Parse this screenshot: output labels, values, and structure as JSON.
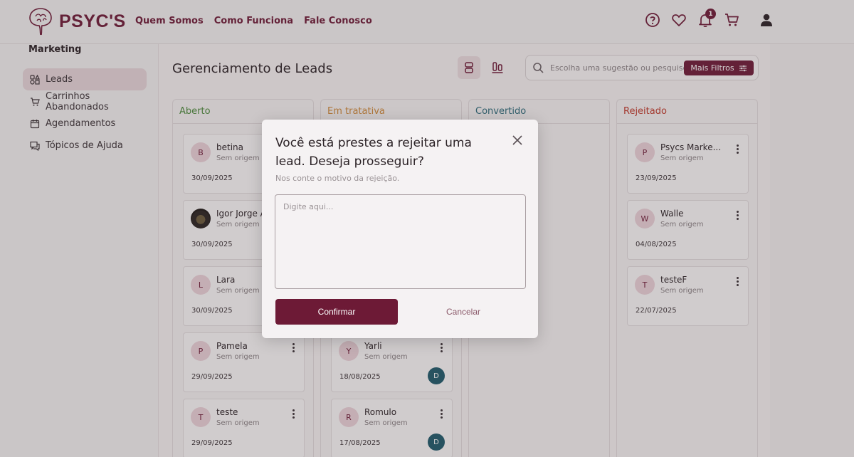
{
  "header": {
    "brand": "PSYC'S",
    "nav": [
      "Quem Somos",
      "Como Funciona",
      "Fale Conosco"
    ],
    "notification_count": "1",
    "icons": [
      "help-icon",
      "heart-icon",
      "bell-icon",
      "cart-icon",
      "user-icon"
    ]
  },
  "sidebar": {
    "section_title": "Marketing",
    "items": [
      {
        "label": "Leads",
        "icon": "leads-icon",
        "active": true
      },
      {
        "label": "Carrinhos Abandonados",
        "icon": "cart-icon"
      },
      {
        "label": "Agendamentos",
        "icon": "calendar-icon"
      },
      {
        "label": "Tópicos de Ajuda",
        "icon": "help-topics-icon"
      }
    ]
  },
  "main": {
    "title": "Gerenciamento de Leads",
    "search_placeholder": "Escolha uma sugestão ou pesquise...",
    "filter_label": "Mais Filtros"
  },
  "columns": [
    {
      "title": "Aberto",
      "color": "#4a8a3a",
      "cards": [
        {
          "initial": "B",
          "name": "betina",
          "origin": "Sem origem",
          "date": "30/09/2025"
        },
        {
          "initial": "",
          "name": "Igor Jorge A",
          "origin": "Sem origem",
          "date": "30/09/2025",
          "photo": true
        },
        {
          "initial": "L",
          "name": "Lara",
          "origin": "Sem origem",
          "date": "30/09/2025"
        },
        {
          "initial": "P",
          "name": "Pamela",
          "origin": "Sem origem",
          "date": "29/09/2025"
        },
        {
          "initial": "T",
          "name": "teste",
          "origin": "Sem origem",
          "date": "29/09/2025"
        }
      ]
    },
    {
      "title": "Em tratativa",
      "color": "#d08a3a",
      "cards": [
        {
          "initial": "Y",
          "name": "Yarli",
          "origin": "Sem origem",
          "date": "18/08/2025",
          "assignee": "D"
        },
        {
          "initial": "R",
          "name": "Romulo",
          "origin": "Sem origem",
          "date": "17/08/2025",
          "assignee": "D"
        }
      ]
    },
    {
      "title": "Convertido",
      "color": "#2a6a7a",
      "cards": []
    },
    {
      "title": "Rejeitado",
      "color": "#c0392b",
      "cards": [
        {
          "initial": "P",
          "name": "Psycs Marke...",
          "origin": "Sem origem",
          "date": "23/09/2025"
        },
        {
          "initial": "W",
          "name": "Walle",
          "origin": "Sem origem",
          "date": "04/08/2025"
        },
        {
          "initial": "T",
          "name": "testeF",
          "origin": "Sem origem",
          "date": "22/07/2025"
        }
      ]
    }
  ],
  "modal": {
    "title": "Você está prestes a rejeitar uma lead. Deseja prosseguir?",
    "subtitle": "Nos conte o motivo da rejeição.",
    "placeholder": "Digite aqui...",
    "value": "",
    "confirm_label": "Confirmar",
    "cancel_label": "Cancelar"
  },
  "colors": {
    "brand": "#6d1a36",
    "assignee": "#1e5a6b"
  }
}
